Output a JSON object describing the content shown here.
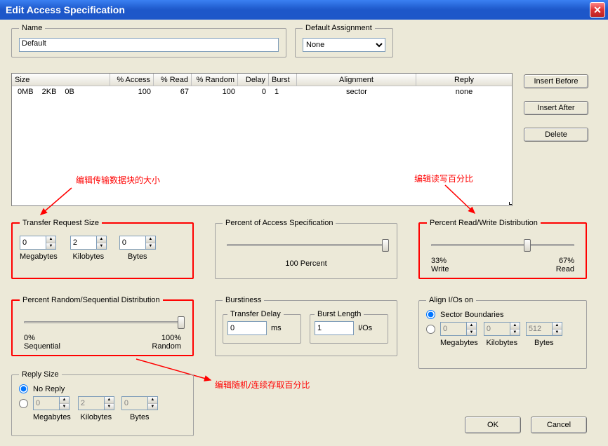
{
  "window": {
    "title": "Edit Access Specification"
  },
  "name_group": {
    "legend": "Name",
    "value": "Default"
  },
  "assign_group": {
    "legend": "Default Assignment",
    "value": "None"
  },
  "buttons": {
    "insert_before": "Insert Before",
    "insert_after": "Insert After",
    "delete": "Delete",
    "ok": "OK",
    "cancel": "Cancel"
  },
  "table": {
    "headers": {
      "size": "Size",
      "access": "% Access",
      "read": "% Read",
      "random": "% Random",
      "delay": "Delay",
      "burst": "Burst",
      "alignment": "Alignment",
      "reply": "Reply"
    },
    "row": {
      "size_mb": "0MB",
      "size_kb": "2KB",
      "size_b": "0B",
      "access": "100",
      "read": "67",
      "random": "100",
      "delay": "0",
      "burst": "1",
      "alignment": "sector",
      "reply": "none"
    }
  },
  "transfer": {
    "legend": "Transfer Request Size",
    "mb": "0",
    "mb_label": "Megabytes",
    "kb": "2",
    "kb_label": "Kilobytes",
    "b": "0",
    "b_label": "Bytes"
  },
  "pct_access": {
    "legend": "Percent of Access Specification",
    "value": "100 Percent"
  },
  "readwrite": {
    "legend": "Percent Read/Write Distribution",
    "left_pct": "33%",
    "left_label": "Write",
    "right_pct": "67%",
    "right_label": "Read"
  },
  "randseq": {
    "legend": "Percent Random/Sequential Distribution",
    "left_pct": "0%",
    "left_label": "Sequential",
    "right_pct": "100%",
    "right_label": "Random"
  },
  "burst": {
    "legend": "Burstiness",
    "delay_legend": "Transfer Delay",
    "delay_val": "0",
    "delay_unit": "ms",
    "length_legend": "Burst Length",
    "length_val": "1",
    "length_unit": "I/Os"
  },
  "align": {
    "legend": "Align I/Os on",
    "sector": "Sector Boundaries",
    "mb": "0",
    "kb": "0",
    "b": "512",
    "mb_label": "Megabytes",
    "kb_label": "Kilobytes",
    "b_label": "Bytes"
  },
  "reply": {
    "legend": "Reply Size",
    "noreply": "No Reply",
    "mb": "0",
    "kb": "2",
    "b": "0",
    "mb_label": "Megabytes",
    "kb_label": "Kilobytes",
    "b_label": "Bytes"
  },
  "annotations": {
    "size": "编辑传输数据块的大小",
    "rw": "编辑读写百分比",
    "rand": "编辑随机/连续存取百分比"
  }
}
